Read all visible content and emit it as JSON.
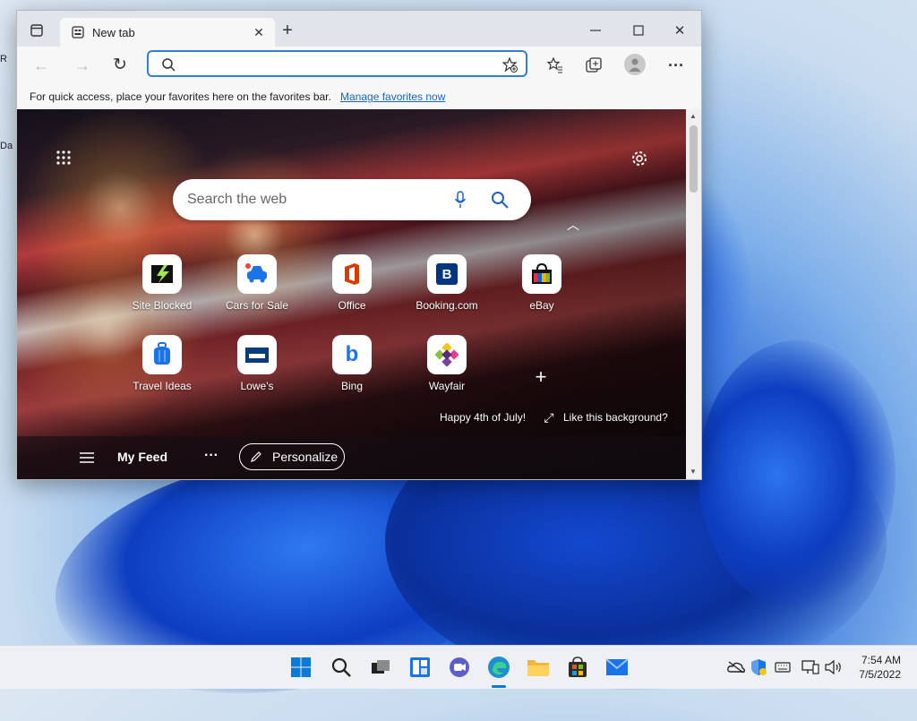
{
  "desktop": {
    "label_top": "R",
    "label_bottom": "Da"
  },
  "browser": {
    "tab": {
      "title": "New tab"
    },
    "address": {
      "value": "",
      "placeholder": ""
    },
    "favorites_bar": {
      "text": "For quick access, place your favorites here on the favorites bar.",
      "link": "Manage favorites now"
    }
  },
  "newtab": {
    "search_placeholder": "Search the web",
    "tiles": [
      {
        "label": "Site Blocked",
        "icon": "site-blocked-icon"
      },
      {
        "label": "Cars for Sale",
        "icon": "car-icon"
      },
      {
        "label": "Office",
        "icon": "office-icon"
      },
      {
        "label": "Booking.com",
        "icon": "booking-icon",
        "glyph": "B"
      },
      {
        "label": "eBay",
        "icon": "shopping-bag-icon"
      },
      {
        "label": "Travel Ideas",
        "icon": "luggage-icon"
      },
      {
        "label": "Lowe's",
        "icon": "lowes-icon"
      },
      {
        "label": "Bing",
        "icon": "bing-icon",
        "glyph": "b"
      },
      {
        "label": "Wayfair",
        "icon": "wayfair-icon"
      }
    ],
    "background_caption": "Happy 4th of July!",
    "like_background": "Like this background?",
    "feed": {
      "title": "My Feed",
      "personalize": "Personalize"
    }
  },
  "taskbar": {
    "clock_time": "7:54 AM",
    "clock_date": "7/5/2022"
  },
  "colors": {
    "accent": "#2f80d8",
    "link": "#1a65c2",
    "windows_blue": "#0078d4"
  }
}
